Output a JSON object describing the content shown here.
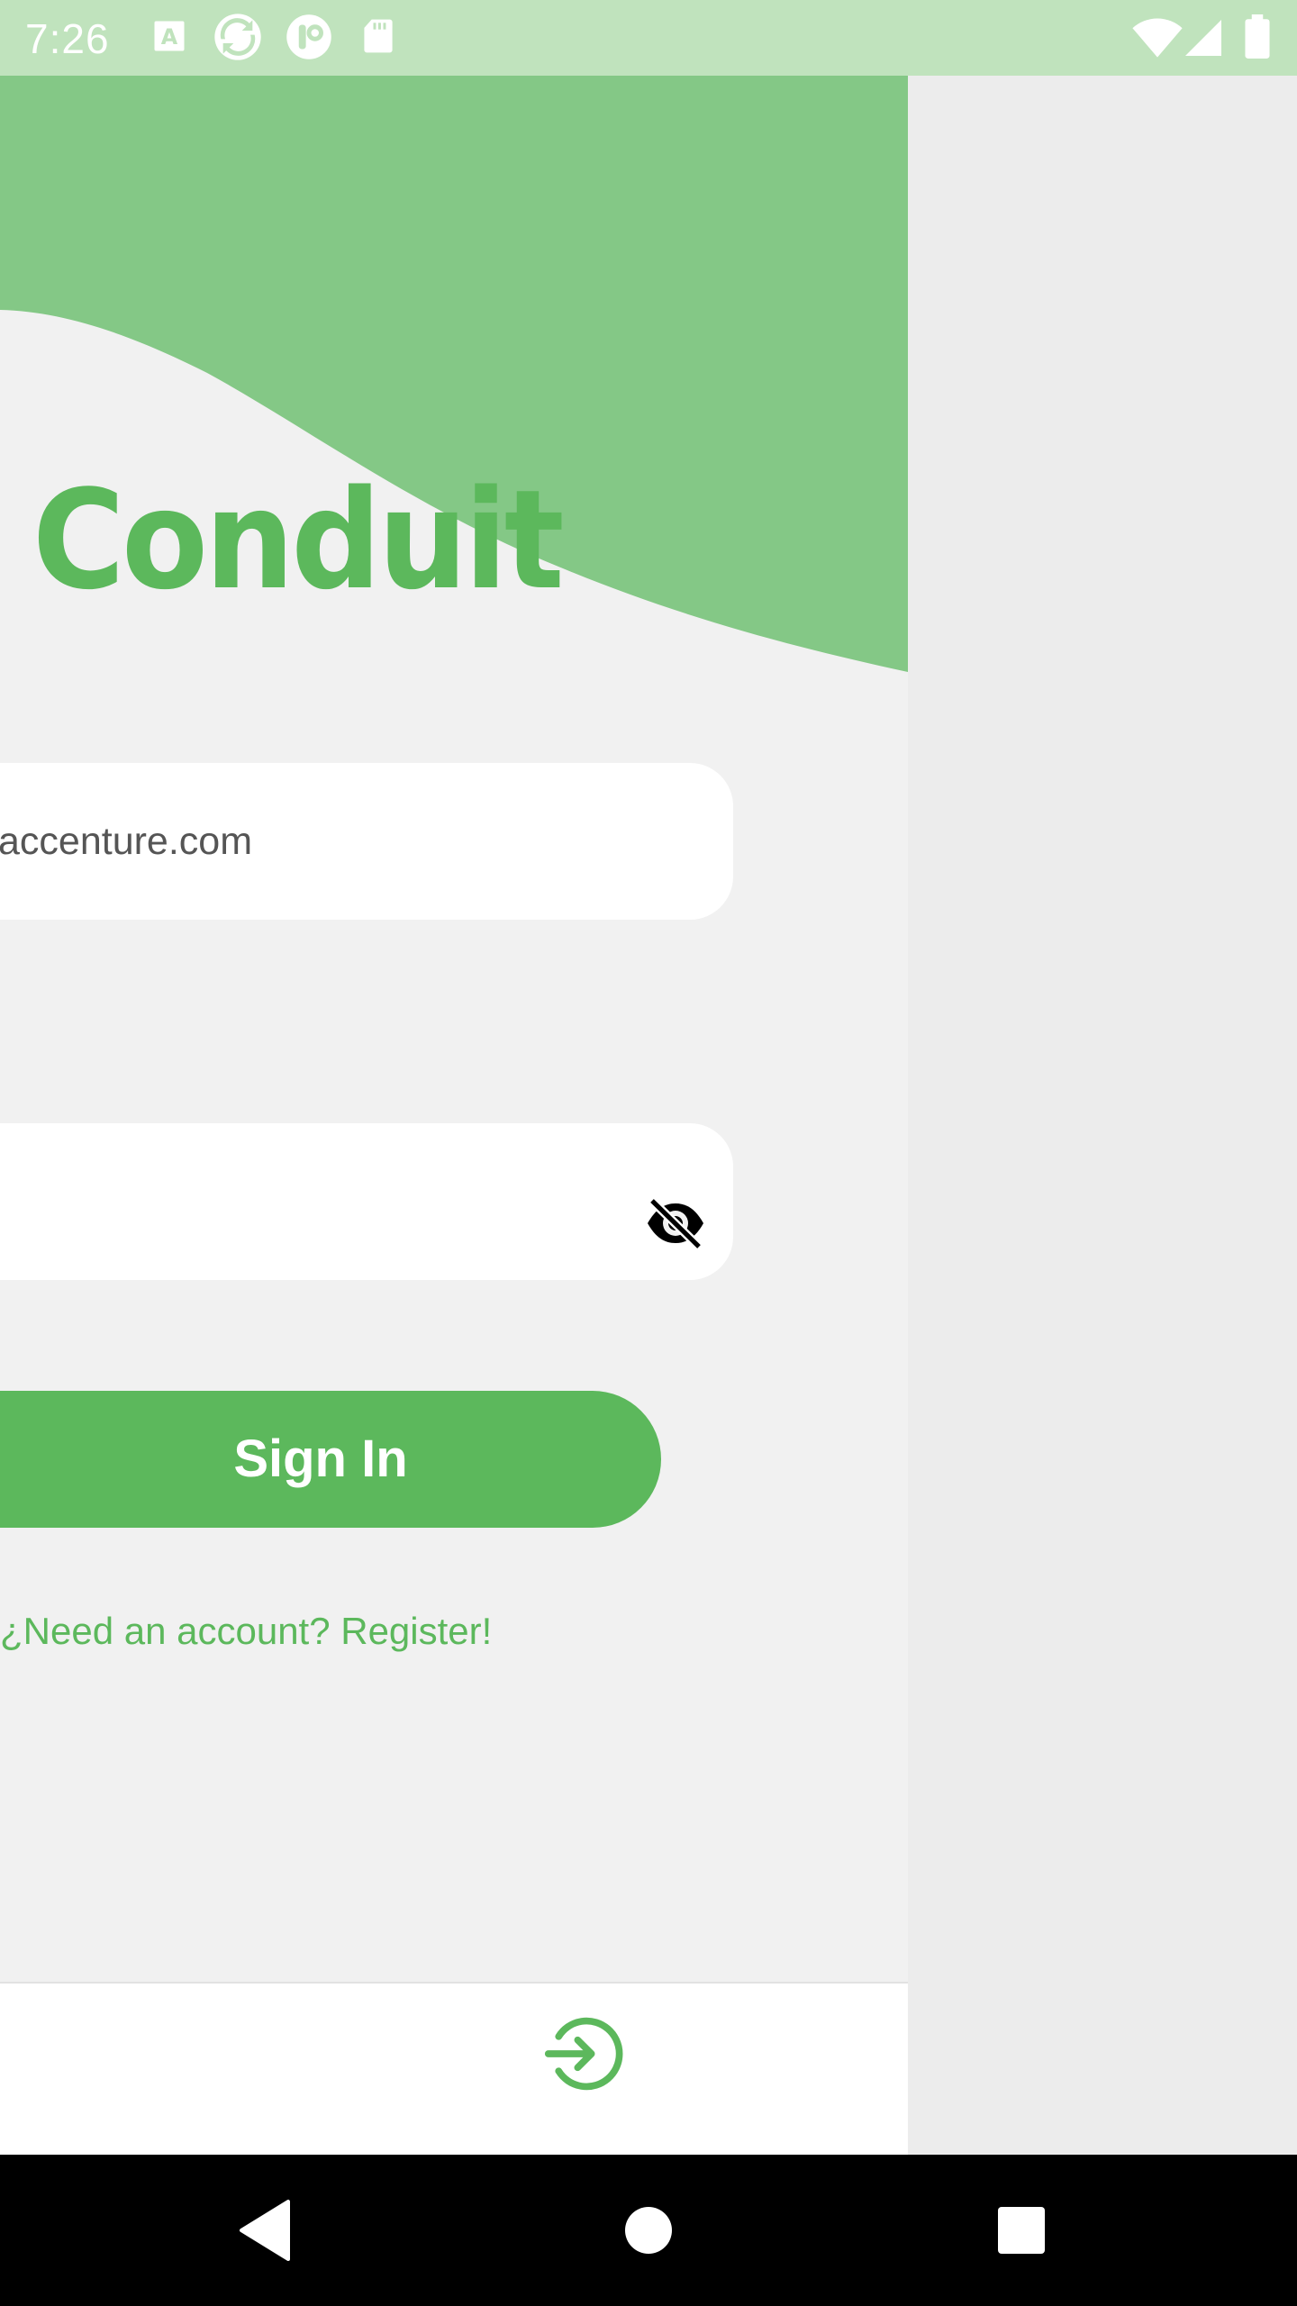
{
  "status_bar": {
    "time": "7:26",
    "left_icons": [
      "a-notification-icon",
      "sync-app-icon",
      "power-app-icon",
      "sd-card-icon"
    ],
    "right_icons": [
      "wifi-icon",
      "signal-icon",
      "battery-icon"
    ]
  },
  "app": {
    "logo_title": "Conduit",
    "email_field": {
      "value": "accenture.com"
    },
    "password_field": {
      "value": "",
      "toggle_icon": "visibility-off-icon"
    },
    "signin_button": {
      "label": "Sign In"
    },
    "register_link": {
      "label": "¿Need an account? Register!"
    },
    "bottom_nav": {
      "icon": "login-icon"
    }
  },
  "colors": {
    "brand_green": "#5cb85c",
    "header_green": "#84c886",
    "status_bar": "#c0e3bd",
    "background": "#f1f1f1"
  },
  "nav_bar": {
    "buttons": [
      "back-icon",
      "home-icon",
      "recents-icon"
    ]
  }
}
